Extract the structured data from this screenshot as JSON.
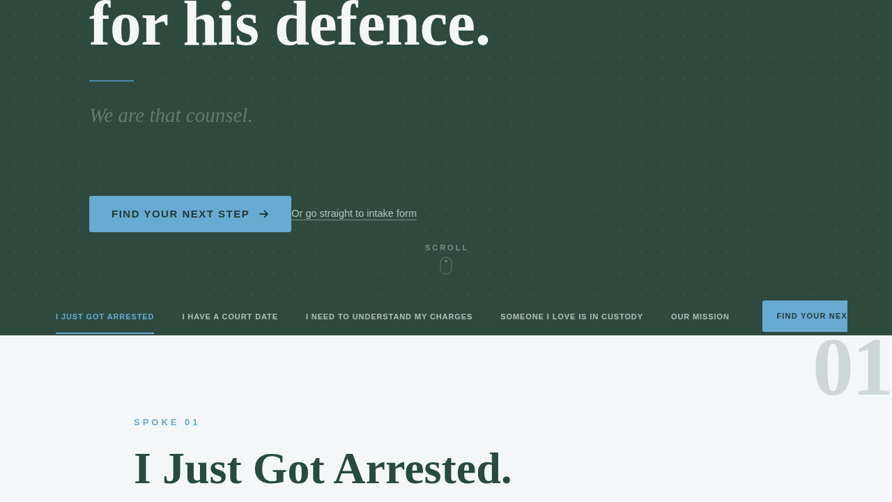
{
  "hero": {
    "headline": "for his defence.",
    "tagline": "We are that counsel.",
    "primary_button": "FIND YOUR NEXT STEP",
    "secondary_link": "Or go straight to intake form",
    "scroll_label": "SCROLL"
  },
  "nav": {
    "tabs": [
      {
        "label": "I JUST GOT ARRESTED",
        "selected": true
      },
      {
        "label": "I HAVE A COURT DATE",
        "selected": false
      },
      {
        "label": "I NEED TO UNDERSTAND MY CHARGES",
        "selected": false
      },
      {
        "label": "SOMEONE I LOVE IS IN CUSTODY",
        "selected": false
      },
      {
        "label": "OUR MISSION",
        "selected": false
      }
    ],
    "cta_button": "FIND YOUR NEX"
  },
  "section": {
    "number": "01",
    "eyebrow": "SPOKE 01",
    "title": "I Just Got Arrested."
  }
}
